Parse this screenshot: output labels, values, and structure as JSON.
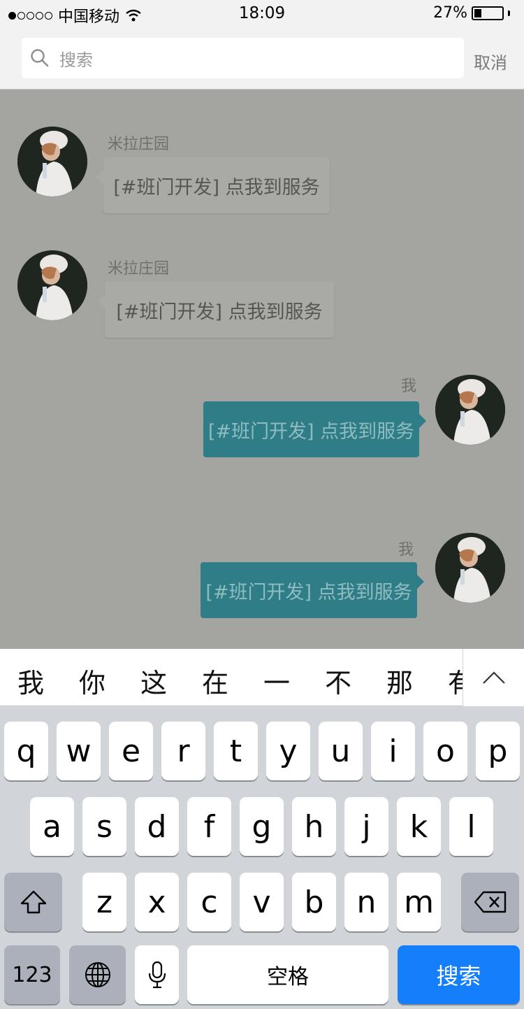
{
  "status_bar": {
    "carrier": "中国移动",
    "time": "18:09",
    "battery": "27%",
    "battery_level": 0.27
  },
  "search": {
    "placeholder": "搜索",
    "cancel_label": "取消"
  },
  "messages": [
    {
      "sender": "米拉庄园",
      "text": "[#班门开发] 点我到服务",
      "direction": "in"
    },
    {
      "sender": "米拉庄园",
      "text": "[#班门开发] 点我到服务",
      "direction": "in"
    },
    {
      "sender": "我",
      "text": "[#班门开发] 点我到服务",
      "direction": "out"
    },
    {
      "sender": "我",
      "text": "[#班门开发] 点我到服务",
      "direction": "out"
    }
  ],
  "candidates": [
    "我",
    "你",
    "这",
    "在",
    "一",
    "不",
    "那",
    "有"
  ],
  "keyboard": {
    "row1": [
      "q",
      "w",
      "e",
      "r",
      "t",
      "y",
      "u",
      "i",
      "o",
      "p"
    ],
    "row2": [
      "a",
      "s",
      "d",
      "f",
      "g",
      "h",
      "j",
      "k",
      "l"
    ],
    "row3": [
      "z",
      "x",
      "c",
      "v",
      "b",
      "n",
      "m"
    ],
    "numbers_label": "123",
    "space_label": "空格",
    "search_label": "搜索"
  },
  "colors": {
    "accent": "#147efb",
    "outgoing_bubble": "#2f7e87",
    "overlay": "#a4a5a0"
  }
}
